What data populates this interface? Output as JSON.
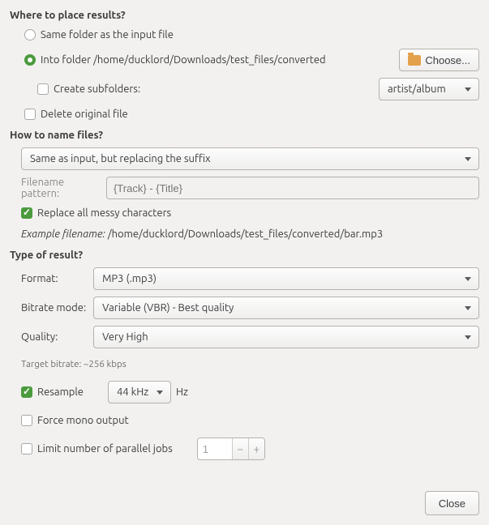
{
  "where": {
    "title": "Where to place results?",
    "same_folder_label": "Same folder as the input file",
    "into_folder_label_prefix": "Into folder ",
    "into_folder_path": "/home/ducklord/Downloads/test_files/converted",
    "choose_label": "Choose...",
    "create_subfolders_label": "Create subfolders:",
    "subfolder_pattern": "artist/album",
    "delete_original_label": "Delete original file"
  },
  "howname": {
    "title": "How to name files?",
    "naming_mode": "Same as input, but replacing the suffix",
    "pattern_label": "Filename pattern:",
    "pattern_placeholder": "{Track} - {Title}",
    "replace_messy_label": "Replace all messy characters",
    "example_prefix": "Example filename: ",
    "example_path": "/home/ducklord/Downloads/test_files/converted/bar.mp3"
  },
  "result": {
    "title": "Type of result?",
    "format_label": "Format:",
    "format_value": "MP3 (.mp3)",
    "bitrate_mode_label": "Bitrate mode:",
    "bitrate_mode_value": "Variable (VBR) - Best quality",
    "quality_label": "Quality:",
    "quality_value": "Very High",
    "target_bitrate": "Target bitrate: ~256 kbps",
    "resample_label": "Resample",
    "resample_value": "44 kHz",
    "resample_unit": "Hz",
    "force_mono_label": "Force mono output",
    "limit_jobs_label": "Limit number of parallel jobs",
    "limit_jobs_value": "1"
  },
  "footer": {
    "close_label": "Close"
  }
}
